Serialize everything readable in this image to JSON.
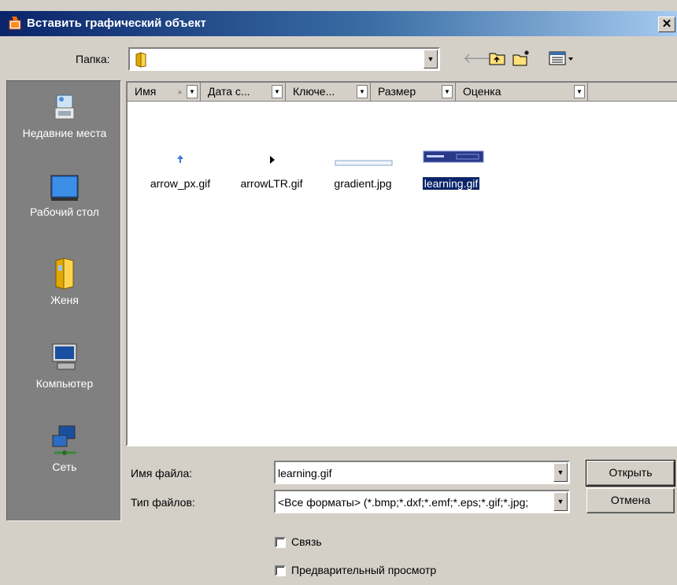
{
  "window": {
    "title": "Вставить графический объект",
    "close_glyph": "✕"
  },
  "lookin": {
    "label": "Папка:",
    "value": ""
  },
  "toolbar": [
    "back-icon",
    "up-folder-icon",
    "new-folder-icon",
    "view-menu-icon"
  ],
  "places": [
    {
      "label": "Недавние места",
      "icon": "recent-places-icon"
    },
    {
      "label": "Рабочий стол",
      "icon": "desktop-icon"
    },
    {
      "label": "Женя",
      "icon": "user-folder-icon"
    },
    {
      "label": "Компьютер",
      "icon": "computer-icon"
    },
    {
      "label": "Сеть",
      "icon": "network-icon"
    }
  ],
  "columns": [
    {
      "label": "Имя"
    },
    {
      "label": "Дата с..."
    },
    {
      "label": "Ключе..."
    },
    {
      "label": "Размер"
    },
    {
      "label": "Оценка"
    }
  ],
  "files": [
    {
      "name": "arrow_px.gif",
      "selected": false
    },
    {
      "name": "arrowLTR.gif",
      "selected": false
    },
    {
      "name": "gradient.jpg",
      "selected": false
    },
    {
      "name": "learning.gif",
      "selected": true
    }
  ],
  "filename": {
    "label": "Имя файла:",
    "value": "learning.gif"
  },
  "filetype": {
    "label": "Тип файлов:",
    "value": "<Все форматы> (*.bmp;*.dxf;*.emf;*.eps;*.gif;*.jpg;"
  },
  "buttons": {
    "open": "Открыть",
    "cancel": "Отмена"
  },
  "options": {
    "link": {
      "label": "Связь",
      "checked": false
    },
    "preview": {
      "label": "Предварительный просмотр",
      "checked": false
    }
  },
  "colors": {
    "titlebar_start": "#0a246a",
    "selection": "#0a246a",
    "dialog_face": "#d4d0c8",
    "places_bg": "#808080"
  }
}
